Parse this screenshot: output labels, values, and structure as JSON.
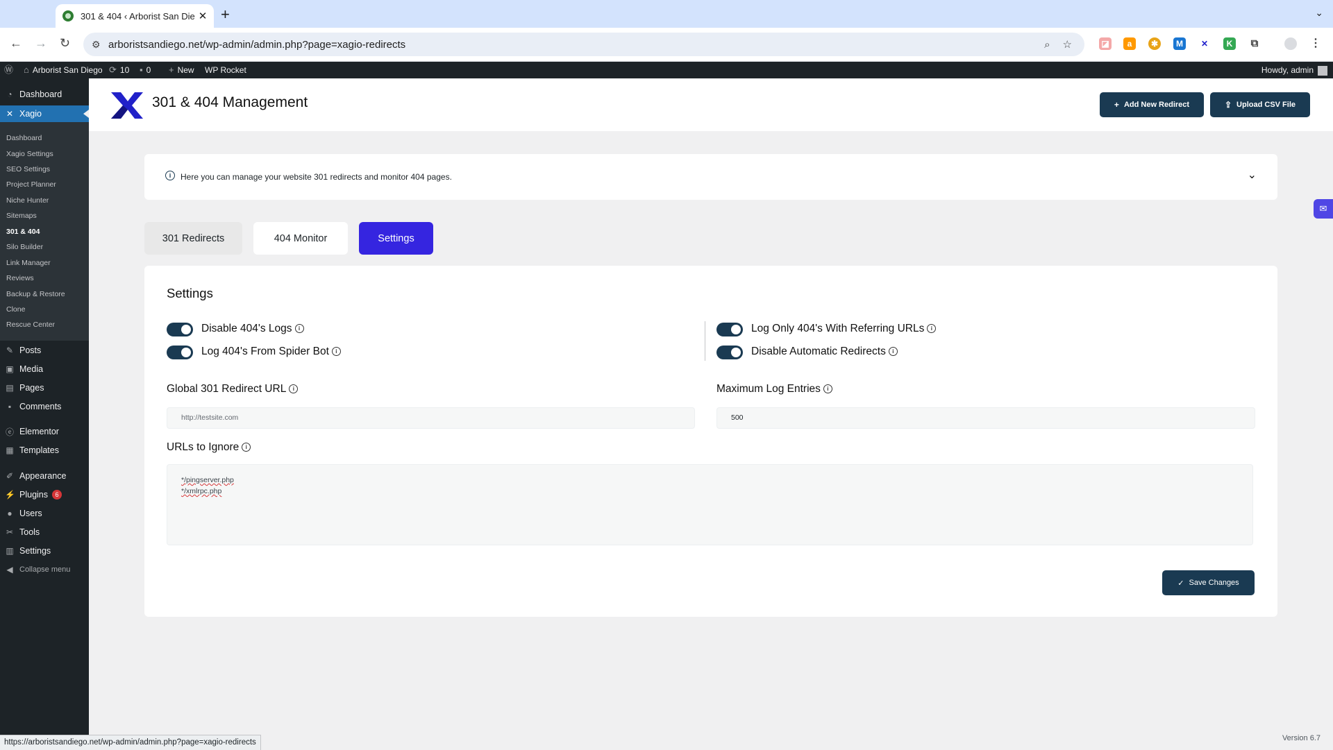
{
  "browser": {
    "tab_title": "301 & 404 ‹ Arborist San Die",
    "tab_close": "✕",
    "new_tab": "+",
    "url": "arboristsandiego.net/wp-admin/admin.php?page=xagio-redirects"
  },
  "adminbar": {
    "site_name": "Arborist San Diego",
    "updates_count": "10",
    "comments_count": "0",
    "new_label": "New",
    "wp_rocket": "WP Rocket",
    "howdy": "Howdy, admin"
  },
  "sidebar": {
    "dashboard": "Dashboard",
    "xagio": "Xagio",
    "submenu": [
      "Dashboard",
      "Xagio Settings",
      "SEO Settings",
      "Project Planner",
      "Niche Hunter",
      "Sitemaps",
      "301 & 404",
      "Silo Builder",
      "Link Manager",
      "Reviews",
      "Backup & Restore",
      "Clone",
      "Rescue Center"
    ],
    "items": [
      "Posts",
      "Media",
      "Pages",
      "Comments",
      "Elementor",
      "Templates",
      "Appearance",
      "Plugins",
      "Users",
      "Tools",
      "Settings",
      "Collapse menu"
    ],
    "plugins_badge": "6"
  },
  "header": {
    "title": "301 & 404 Management",
    "add_redirect": "Add New Redirect",
    "upload_csv": "Upload CSV File"
  },
  "info": {
    "text": "Here you can manage your website 301 redirects and monitor 404 pages."
  },
  "tabs": [
    "301 Redirects",
    "404 Monitor",
    "Settings"
  ],
  "settings": {
    "title": "Settings",
    "toggles": {
      "disable_404_logs": "Disable 404's Logs",
      "log_spider_bot": "Log 404's From Spider Bot",
      "log_referring": "Log Only 404's With Referring URLs",
      "disable_auto_redirects": "Disable Automatic Redirects"
    },
    "global_redirect_label": "Global 301 Redirect URL",
    "global_redirect_placeholder": "http://testsite.com",
    "max_log_label": "Maximum Log Entries",
    "max_log_value": "500",
    "ignore_label": "URLs to Ignore",
    "ignore_lines": [
      "*/pingserver.php",
      "*/xmlrpc.php"
    ],
    "save": "Save Changes"
  },
  "status_url": "https://arboristsandiego.net/wp-admin/admin.php?page=xagio-redirects",
  "version": "Version 6.7",
  "colors": {
    "primary_dark": "#1a3a52",
    "active_tab": "#3525e0",
    "wp_admin_bar": "#1d2327",
    "wp_active": "#2271b1"
  }
}
